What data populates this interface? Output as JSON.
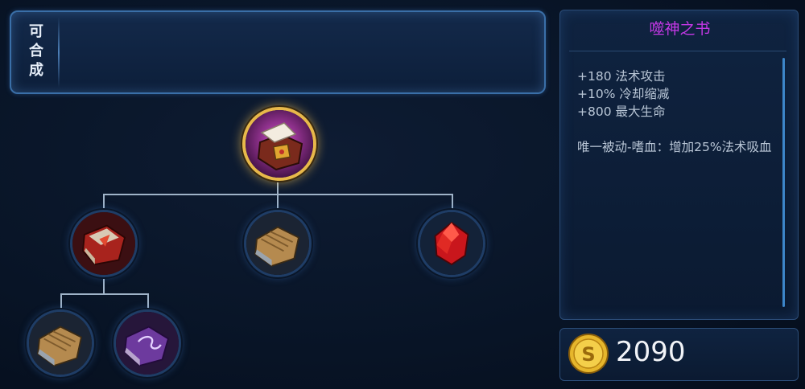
{
  "compose": {
    "label": "可合成"
  },
  "item": {
    "name": "噬神之书",
    "stats": [
      "+180 法术攻击",
      "+10% 冷却缩减",
      "+800 最大生命"
    ],
    "passive": "唯一被动-嗜血：增加25%法术吸血",
    "price": "2090"
  },
  "tree": {
    "root": {
      "icon": "book-of-god-devourer-icon"
    },
    "children": [
      {
        "icon": "red-spell-book-icon"
      },
      {
        "icon": "plain-wooden-book-icon"
      },
      {
        "icon": "red-crystal-icon"
      }
    ],
    "grandchildren": [
      {
        "icon": "plain-wooden-book-icon"
      },
      {
        "icon": "purple-rune-book-icon"
      }
    ]
  },
  "colors": {
    "name": "#c438e6",
    "selected_ring": "#e8b84a",
    "tree_lines": "#9fb3c8"
  }
}
